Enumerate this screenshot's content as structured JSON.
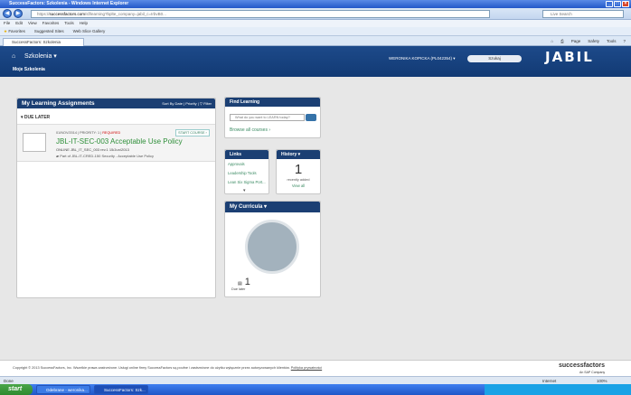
{
  "window": {
    "title": "SuccessFactors: Szkolenia - Windows Internet Explorer",
    "url_prefix": "https://",
    "url_host": "successfactors.com",
    "url_rest": "/sf/learning?bplte_company=jabil_c=IrbvB0...",
    "search_placeholder": "Live Search"
  },
  "menu": [
    "File",
    "Edit",
    "View",
    "Favorites",
    "Tools",
    "Help"
  ],
  "favorites": {
    "favorites_label": "Favorites",
    "suggested": "Suggested Sites",
    "slice": "Web Slice Gallery"
  },
  "tab": {
    "label": "SuccessFactors: Szkolenia"
  },
  "cmdbar": [
    "Page",
    "Safety",
    "Tools"
  ],
  "header": {
    "module": "Szkolenia",
    "subtitle": "Moje Szkolenia",
    "username": "WERONIKA KOPICKA (PL042354)",
    "search_label": "Szukaj",
    "logo": "JABIL"
  },
  "assignments": {
    "title": "My Learning Assignments",
    "sort": "Sort By Date | Priority",
    "filter": "Filter",
    "group": "DUE LATER",
    "item": {
      "date": "01/NOV/2014",
      "priority": "PRIORITY: 1",
      "required": "REQUIRED",
      "start": "START COURSE",
      "title": "JBL-IT-SEC-003 Acceptable Use Policy",
      "code": "ONLINE JBL_IT_SEC_003 rev.1 15/Jun/2013",
      "part": "Part of JBL-IT-CRED-150 Security - Acceptable Use Policy"
    }
  },
  "find": {
    "title": "Find Learning",
    "placeholder": "What do you want to LEARN today?",
    "browse": "Browse all courses"
  },
  "links": {
    "title": "Links",
    "items": [
      "Approvals",
      "Leadership Tools",
      "Lean Six Sigma Port..."
    ]
  },
  "history": {
    "title": "History",
    "count": "1",
    "label": "recently added",
    "view_all": "View all"
  },
  "curricula": {
    "title": "My Curricula",
    "count": "1",
    "label": "Due later"
  },
  "footer": {
    "copyright": "Copyright © 2013 SuccessFactors, Inc. Wszelkie prawa zastrzeżone. Usługi online firmy SuccessFactors są poufne i zastrzeżone do użytku wyłącznie przez autoryzowanych klientów.",
    "privacy": "Polityka prywatności",
    "brand": "successfactors",
    "brand_sub": "An SAP Company"
  },
  "status": {
    "left": "Done",
    "zone": "Internet",
    "zoom": "100%"
  },
  "taskbar": {
    "start": "start",
    "tasks": [
      "Odebrane - weronika...",
      "SuccessFactors: Szk..."
    ]
  }
}
